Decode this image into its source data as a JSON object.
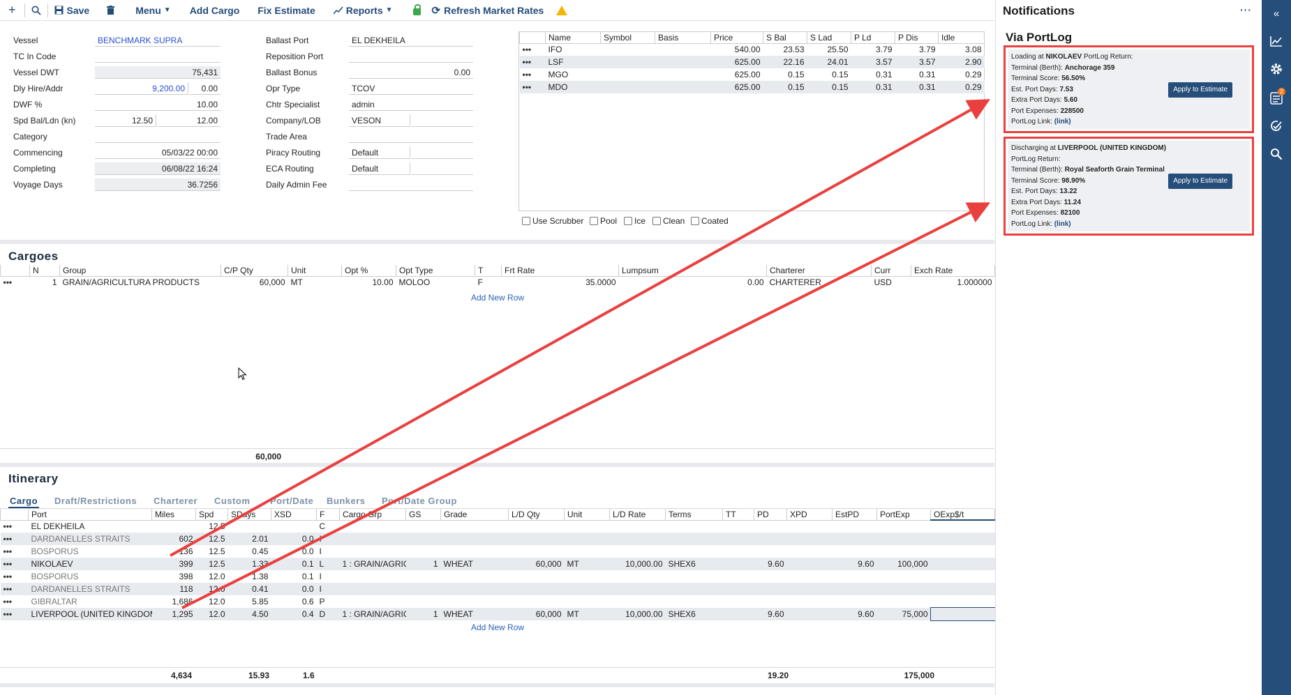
{
  "toolbar": {
    "add_icon": "plus-icon",
    "search_icon": "search-icon",
    "save_label": "Save",
    "delete_icon": "trash-icon",
    "menu_label": "Menu",
    "add_cargo_label": "Add Cargo",
    "fix_estimate_label": "Fix Estimate",
    "reports_label": "Reports",
    "refresh_label": "Refresh Market Rates"
  },
  "vessel_form": {
    "vessel_label": "Vessel",
    "vessel_value": "BENCHMARK SUPRA",
    "tc_code_label": "TC In Code",
    "tc_code_value": "",
    "dwt_label": "Vessel DWT",
    "dwt_value": "75,431",
    "hire_label": "Dly Hire/Addr",
    "hire_value": "9,200.00",
    "addr_value": "0.00",
    "dwf_label": "DWF %",
    "dwf_value": "10.00",
    "spd_label": "Spd Bal/Ldn (kn)",
    "spd_bal": "12.50",
    "spd_ldn": "12.00",
    "category_label": "Category",
    "commencing_label": "Commencing",
    "commencing_value": "05/03/22 00:00",
    "completing_label": "Completing",
    "completing_value": "06/08/22 16:24",
    "voyage_days_label": "Voyage Days",
    "voyage_days_value": "36.7256"
  },
  "port_form": {
    "ballast_port_label": "Ballast Port",
    "ballast_port_value": "EL DEKHEILA",
    "reposition_label": "Reposition Port",
    "reposition_value": "",
    "ballast_bonus_label": "Ballast Bonus",
    "ballast_bonus_value": "0.00",
    "opr_type_label": "Opr Type",
    "opr_type_value": "TCOV",
    "chtr_label": "Chtr Specialist",
    "chtr_value": "admin",
    "company_label": "Company/LOB",
    "company_value": "VESON",
    "trade_area_label": "Trade Area",
    "piracy_label": "Piracy Routing",
    "piracy_value": "Default",
    "eca_label": "ECA Routing",
    "eca_value": "Default",
    "admin_fee_label": "Daily Admin Fee"
  },
  "bunkers": {
    "columns": [
      "Name",
      "Symbol",
      "Basis",
      "Price",
      "S Bal",
      "S Lad",
      "P Ld",
      "P Dis",
      "Idle"
    ],
    "rows": [
      {
        "name": "IFO",
        "symbol": "",
        "basis": "",
        "price": "540.00",
        "sbal": "23.53",
        "slad": "25.50",
        "pld": "3.79",
        "pdis": "3.79",
        "idle": "3.08"
      },
      {
        "name": "LSF",
        "symbol": "",
        "basis": "",
        "price": "625.00",
        "sbal": "22.16",
        "slad": "24.01",
        "pld": "3.57",
        "pdis": "3.57",
        "idle": "2.90"
      },
      {
        "name": "MGO",
        "symbol": "",
        "basis": "",
        "price": "625.00",
        "sbal": "0.15",
        "slad": "0.15",
        "pld": "0.31",
        "pdis": "0.31",
        "idle": "0.29"
      },
      {
        "name": "MDO",
        "symbol": "",
        "basis": "",
        "price": "625.00",
        "sbal": "0.15",
        "slad": "0.15",
        "pld": "0.31",
        "pdis": "0.31",
        "idle": "0.29"
      }
    ],
    "checkboxes": [
      "Use Scrubber",
      "Pool",
      "Ice",
      "Clean",
      "Coated"
    ]
  },
  "cargoes": {
    "title": "Cargoes",
    "columns": [
      "N",
      "Group",
      "C/P Qty",
      "Unit",
      "Opt %",
      "Opt Type",
      "T",
      "Frt Rate",
      "Lumpsum",
      "Charterer",
      "Curr",
      "Exch Rate"
    ],
    "rows": [
      {
        "n": "1",
        "group": "GRAIN/AGRICULTURA PRODUCTS",
        "qty": "60,000",
        "unit": "MT",
        "opt": "10.00",
        "opt_type": "MOLOO",
        "t": "F",
        "frt": "35.0000",
        "lumpsum": "0.00",
        "charterer": "CHARTERER",
        "curr": "USD",
        "exch": "1.000000"
      }
    ],
    "add_row": "Add New Row",
    "total_qty": "60,000"
  },
  "itinerary": {
    "title": "Itinerary",
    "tabs": [
      "Cargo",
      "Draft/Restrictions",
      "Charterer",
      "Custom",
      "Port/Date",
      "Bunkers",
      "Port/Date Group"
    ],
    "columns": [
      "Port",
      "Miles",
      "Spd",
      "SDays",
      "XSD",
      "F",
      "Cargo Grp",
      "GS",
      "Grade",
      "L/D Qty",
      "Unit",
      "L/D Rate",
      "Terms",
      "TT",
      "PD",
      "XPD",
      "EstPD",
      "PortExp",
      "OExp$/t"
    ],
    "rows": [
      {
        "port": "EL DEKHEILA",
        "miles": "",
        "spd": "12.5",
        "sdays": "",
        "xsd": "",
        "f": "C",
        "cgrp": "",
        "gs": "",
        "grade": "",
        "qty": "",
        "unit": "",
        "rate": "",
        "terms": "",
        "tt": "",
        "pd": "",
        "xpd": "",
        "estpd": "",
        "portexp": "",
        "oexp": ""
      },
      {
        "port": "DARDANELLES STRAITS",
        "miles": "602",
        "spd": "12.5",
        "sdays": "2.01",
        "xsd": "0.0",
        "f": "I",
        "cgrp": "",
        "gs": "",
        "grade": "",
        "qty": "",
        "unit": "",
        "rate": "",
        "terms": "",
        "tt": "",
        "pd": "",
        "xpd": "",
        "estpd": "",
        "portexp": "",
        "oexp": ""
      },
      {
        "port": "BOSPORUS",
        "miles": "136",
        "spd": "12.5",
        "sdays": "0.45",
        "xsd": "0.0",
        "f": "I",
        "cgrp": "",
        "gs": "",
        "grade": "",
        "qty": "",
        "unit": "",
        "rate": "",
        "terms": "",
        "tt": "",
        "pd": "",
        "xpd": "",
        "estpd": "",
        "portexp": "",
        "oexp": ""
      },
      {
        "port": "NIKOLAEV",
        "miles": "399",
        "spd": "12.5",
        "sdays": "1.33",
        "xsd": "0.1",
        "f": "L",
        "cgrp": "1 : GRAIN/AGRIC",
        "gs": "1",
        "grade": "WHEAT",
        "qty": "60,000",
        "unit": "MT",
        "rate": "10,000.00",
        "terms": "SHEX6",
        "tt": "",
        "pd": "9.60",
        "xpd": "",
        "estpd": "9.60",
        "portexp": "100,000",
        "oexp": ""
      },
      {
        "port": "BOSPORUS",
        "miles": "398",
        "spd": "12.0",
        "sdays": "1.38",
        "xsd": "0.1",
        "f": "I",
        "cgrp": "",
        "gs": "",
        "grade": "",
        "qty": "",
        "unit": "",
        "rate": "",
        "terms": "",
        "tt": "",
        "pd": "",
        "xpd": "",
        "estpd": "",
        "portexp": "",
        "oexp": ""
      },
      {
        "port": "DARDANELLES STRAITS",
        "miles": "118",
        "spd": "12.0",
        "sdays": "0.41",
        "xsd": "0.0",
        "f": "I",
        "cgrp": "",
        "gs": "",
        "grade": "",
        "qty": "",
        "unit": "",
        "rate": "",
        "terms": "",
        "tt": "",
        "pd": "",
        "xpd": "",
        "estpd": "",
        "portexp": "",
        "oexp": ""
      },
      {
        "port": "GIBRALTAR",
        "miles": "1,686",
        "spd": "12.0",
        "sdays": "5.85",
        "xsd": "0.6",
        "f": "P",
        "cgrp": "",
        "gs": "",
        "grade": "",
        "qty": "",
        "unit": "",
        "rate": "",
        "terms": "",
        "tt": "",
        "pd": "",
        "xpd": "",
        "estpd": "",
        "portexp": "",
        "oexp": ""
      },
      {
        "port": "LIVERPOOL (UNITED KINGDOM)",
        "miles": "1,295",
        "spd": "12.0",
        "sdays": "4.50",
        "xsd": "0.4",
        "f": "D",
        "cgrp": "1 : GRAIN/AGRIC",
        "gs": "1",
        "grade": "WHEAT",
        "qty": "60,000",
        "unit": "MT",
        "rate": "10,000.00",
        "terms": "SHEX6",
        "tt": "",
        "pd": "9.60",
        "xpd": "",
        "estpd": "9.60",
        "portexp": "75,000",
        "oexp": ""
      }
    ],
    "add_row": "Add New Row",
    "totals": {
      "miles": "4,634",
      "sdays": "15.93",
      "xsd": "1.6",
      "pd": "19.20",
      "portexp": "175,000"
    }
  },
  "notifications": {
    "title": "Notifications",
    "more": "···",
    "subtitle": "Via PortLog",
    "cards": [
      {
        "line1_pre": "Loading at ",
        "line1_port": "NIKOLAEV",
        "line1_post": " PortLog Return:",
        "terminal_label": "Terminal (Berth): ",
        "terminal_value": "Anchorage 359",
        "score_label": "Terminal Score: ",
        "score_value": "56.50%",
        "est_label": "Est. Port Days: ",
        "est_value": "7.53",
        "extra_label": "Extra Port Days: ",
        "extra_value": "5.60",
        "exp_label": "Port Expenses: ",
        "exp_value": "228500",
        "link_label": "PortLog Link: ",
        "link_value": "(link)",
        "button": "Apply to Estimate"
      },
      {
        "line1_pre": "Discharging at ",
        "line1_port": "LIVERPOOL (UNITED KINGDOM)",
        "line1_post": "",
        "line1b": "PortLog Return:",
        "terminal_label": "Terminal (Berth): ",
        "terminal_value": "Royal Seaforth Grain Terminal",
        "score_label": "Terminal Score: ",
        "score_value": "98.90%",
        "est_label": "Est. Port Days: ",
        "est_value": "13.22",
        "extra_label": "Extra Port Days: ",
        "extra_value": "11.24",
        "exp_label": "Port Expenses: ",
        "exp_value": "82100",
        "link_label": "PortLog Link: ",
        "link_value": "(link)",
        "button": "Apply to Estimate"
      }
    ]
  },
  "rail": {
    "collapse_icon": "double-chevron-left-icon",
    "badge": "2"
  }
}
